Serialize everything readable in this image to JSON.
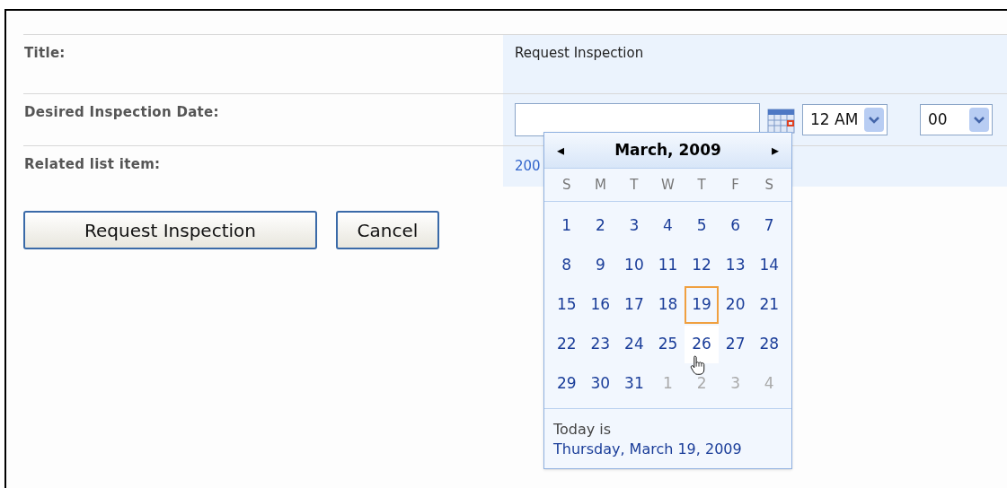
{
  "form": {
    "rows": [
      {
        "kind": "text",
        "label": "Title:",
        "value": "Request Inspection"
      },
      {
        "kind": "datetime",
        "label": "Desired Inspection Date:",
        "hour": "12 AM",
        "minute": "00"
      },
      {
        "kind": "link",
        "label": "Related list item:",
        "value": "200"
      }
    ]
  },
  "buttons": [
    "Request Inspection",
    "Cancel"
  ],
  "calendar": {
    "prev": "◂",
    "month": "March, 2009",
    "next": "▸",
    "weekdays": [
      "S",
      "M",
      "T",
      "W",
      "T",
      "F",
      "S"
    ],
    "weeks": [
      [
        {
          "day": "1",
          "other_month": false,
          "today": false,
          "hovered": false
        },
        {
          "day": "2",
          "other_month": false,
          "today": false,
          "hovered": false
        },
        {
          "day": "3",
          "other_month": false,
          "today": false,
          "hovered": false
        },
        {
          "day": "4",
          "other_month": false,
          "today": false,
          "hovered": false
        },
        {
          "day": "5",
          "other_month": false,
          "today": false,
          "hovered": false
        },
        {
          "day": "6",
          "other_month": false,
          "today": false,
          "hovered": false
        },
        {
          "day": "7",
          "other_month": false,
          "today": false,
          "hovered": false
        }
      ],
      [
        {
          "day": "8",
          "other_month": false,
          "today": false,
          "hovered": false
        },
        {
          "day": "9",
          "other_month": false,
          "today": false,
          "hovered": false
        },
        {
          "day": "10",
          "other_month": false,
          "today": false,
          "hovered": false
        },
        {
          "day": "11",
          "other_month": false,
          "today": false,
          "hovered": false
        },
        {
          "day": "12",
          "other_month": false,
          "today": false,
          "hovered": false
        },
        {
          "day": "13",
          "other_month": false,
          "today": false,
          "hovered": false
        },
        {
          "day": "14",
          "other_month": false,
          "today": false,
          "hovered": false
        }
      ],
      [
        {
          "day": "15",
          "other_month": false,
          "today": false,
          "hovered": false
        },
        {
          "day": "16",
          "other_month": false,
          "today": false,
          "hovered": false
        },
        {
          "day": "17",
          "other_month": false,
          "today": false,
          "hovered": false
        },
        {
          "day": "18",
          "other_month": false,
          "today": false,
          "hovered": false
        },
        {
          "day": "19",
          "other_month": false,
          "today": true,
          "hovered": false
        },
        {
          "day": "20",
          "other_month": false,
          "today": false,
          "hovered": false
        },
        {
          "day": "21",
          "other_month": false,
          "today": false,
          "hovered": false
        }
      ],
      [
        {
          "day": "22",
          "other_month": false,
          "today": false,
          "hovered": false
        },
        {
          "day": "23",
          "other_month": false,
          "today": false,
          "hovered": false
        },
        {
          "day": "24",
          "other_month": false,
          "today": false,
          "hovered": false
        },
        {
          "day": "25",
          "other_month": false,
          "today": false,
          "hovered": false
        },
        {
          "day": "26",
          "other_month": false,
          "today": false,
          "hovered": true
        },
        {
          "day": "27",
          "other_month": false,
          "today": false,
          "hovered": false
        },
        {
          "day": "28",
          "other_month": false,
          "today": false,
          "hovered": false
        }
      ],
      [
        {
          "day": "29",
          "other_month": false,
          "today": false,
          "hovered": false
        },
        {
          "day": "30",
          "other_month": false,
          "today": false,
          "hovered": false
        },
        {
          "day": "31",
          "other_month": false,
          "today": false,
          "hovered": false
        },
        {
          "day": "1",
          "other_month": true,
          "today": false,
          "hovered": false
        },
        {
          "day": "2",
          "other_month": true,
          "today": false,
          "hovered": false
        },
        {
          "day": "3",
          "other_month": true,
          "today": false,
          "hovered": false
        },
        {
          "day": "4",
          "other_month": true,
          "today": false,
          "hovered": false
        }
      ]
    ],
    "today_caption": "Today is",
    "today_link": "Thursday, March 19, 2009"
  }
}
